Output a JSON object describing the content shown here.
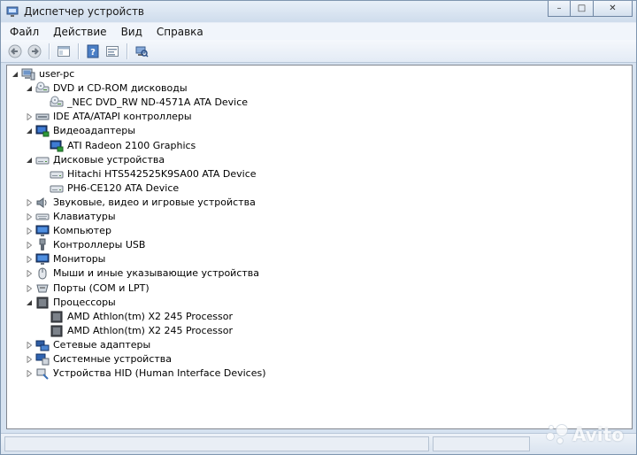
{
  "window": {
    "title": "Диспетчер устройств",
    "caption_minimize": "–",
    "caption_restore": "□",
    "caption_close": "✕"
  },
  "menu": [
    "Файл",
    "Действие",
    "Вид",
    "Справка"
  ],
  "toolbar": {
    "buttons": [
      "back-icon",
      "forward-icon",
      "properties-view-icon",
      "help-icon",
      "show-hidden-icon",
      "scan-hardware-icon"
    ]
  },
  "tree": [
    {
      "label": "user-pc",
      "level": 0,
      "state": "expanded",
      "icon": "computer-icon"
    },
    {
      "label": "DVD и CD-ROM дисководы",
      "level": 1,
      "state": "expanded",
      "icon": "dvd-drive-icon"
    },
    {
      "label": "_NEC DVD_RW ND-4571A ATA Device",
      "level": 2,
      "state": "leaf",
      "icon": "dvd-drive-icon"
    },
    {
      "label": "IDE ATA/ATAPI контроллеры",
      "level": 1,
      "state": "collapsed",
      "icon": "ide-controller-icon"
    },
    {
      "label": "Видеоадаптеры",
      "level": 1,
      "state": "expanded",
      "icon": "display-adapter-icon"
    },
    {
      "label": "ATI Radeon 2100 Graphics",
      "level": 2,
      "state": "leaf",
      "icon": "display-adapter-icon"
    },
    {
      "label": "Дисковые устройства",
      "level": 1,
      "state": "expanded",
      "icon": "disk-drive-icon"
    },
    {
      "label": "Hitachi HTS542525K9SA00 ATA Device",
      "level": 2,
      "state": "leaf",
      "icon": "disk-drive-icon"
    },
    {
      "label": "PH6-CE120 ATA Device",
      "level": 2,
      "state": "leaf",
      "icon": "disk-drive-icon"
    },
    {
      "label": "Звуковые, видео и игровые устройства",
      "level": 1,
      "state": "collapsed",
      "icon": "sound-icon"
    },
    {
      "label": "Клавиатуры",
      "level": 1,
      "state": "collapsed",
      "icon": "keyboard-icon"
    },
    {
      "label": "Компьютер",
      "level": 1,
      "state": "collapsed",
      "icon": "monitor-icon"
    },
    {
      "label": "Контроллеры USB",
      "level": 1,
      "state": "collapsed",
      "icon": "usb-icon"
    },
    {
      "label": "Мониторы",
      "level": 1,
      "state": "collapsed",
      "icon": "monitor-icon"
    },
    {
      "label": "Мыши и иные указывающие устройства",
      "level": 1,
      "state": "collapsed",
      "icon": "mouse-icon"
    },
    {
      "label": "Порты (COM и LPT)",
      "level": 1,
      "state": "collapsed",
      "icon": "port-icon"
    },
    {
      "label": "Процессоры",
      "level": 1,
      "state": "expanded",
      "icon": "processor-icon"
    },
    {
      "label": "AMD Athlon(tm) X2 245 Processor",
      "level": 2,
      "state": "leaf",
      "icon": "processor-icon"
    },
    {
      "label": "AMD Athlon(tm) X2 245 Processor",
      "level": 2,
      "state": "leaf",
      "icon": "processor-icon"
    },
    {
      "label": "Сетевые адаптеры",
      "level": 1,
      "state": "collapsed",
      "icon": "network-adapter-icon"
    },
    {
      "label": "Системные устройства",
      "level": 1,
      "state": "collapsed",
      "icon": "system-device-icon"
    },
    {
      "label": "Устройства HID (Human Interface Devices)",
      "level": 1,
      "state": "collapsed",
      "icon": "hid-icon"
    }
  ],
  "watermark": {
    "text": "Avito"
  }
}
